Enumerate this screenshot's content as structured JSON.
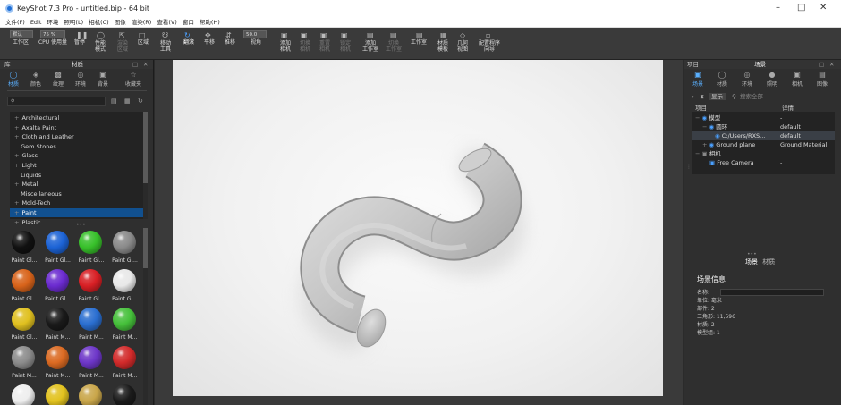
{
  "window": {
    "title": "KeyShot 7.3 Pro - untitled.bip - 64 bit",
    "minimize": "–",
    "maximize": "□",
    "close": "✕"
  },
  "menu": [
    "文件(F)",
    "Edit",
    "环境",
    "照明(L)",
    "相机(C)",
    "图像",
    "渲染(R)",
    "查看(V)",
    "窗口",
    "帮助(H)"
  ],
  "toolbar": {
    "combo1": "默认",
    "combo2": "75 %",
    "combo3": "50.0",
    "buttons": [
      "工作区",
      "CPU 使用量",
      "暂停",
      "性能\n模式",
      "渲染\n区域",
      "区域",
      "移动\n工具",
      "翻滚",
      "平移",
      "推移",
      "视角",
      "添加\n相机",
      "切换\n相机",
      "重置\n相机",
      "锁定\n相机",
      "添加\n工作室",
      "切换\n工作室",
      "工作室",
      "材质\n模板",
      "几何\n视图",
      "配置程序\n向导"
    ]
  },
  "left_panel": {
    "header_left": "库",
    "title": "材质",
    "tabs": [
      "材质",
      "颜色",
      "纹理",
      "环境",
      "背景",
      "收藏夹"
    ],
    "search_placeholder": "",
    "tree": [
      "Architectural",
      "Axalta Paint",
      "Cloth and Leather",
      "Gem Stones",
      "Glass",
      "Light",
      "Liquids",
      "Metal",
      "Miscellaneous",
      "Mold-Tech",
      "Paint",
      "Plastic"
    ],
    "tree_expandable": [
      true,
      true,
      true,
      false,
      true,
      true,
      false,
      true,
      false,
      true,
      true,
      true
    ],
    "selected_index": 10,
    "materials": [
      {
        "label": "Paint Gl...",
        "color": "#111111"
      },
      {
        "label": "Paint Gl...",
        "color": "#1c63d6"
      },
      {
        "label": "Paint Gl...",
        "color": "#37c02a"
      },
      {
        "label": "Paint Gl...",
        "color": "#8a8a8a"
      },
      {
        "label": "Paint Gl...",
        "color": "#d8631a"
      },
      {
        "label": "Paint Gl...",
        "color": "#6b2bd0"
      },
      {
        "label": "Paint Gl...",
        "color": "#d81f24"
      },
      {
        "label": "Paint Gl...",
        "color": "#e8e8e8"
      },
      {
        "label": "Paint Gl...",
        "color": "#e0c01f"
      },
      {
        "label": "Paint M...",
        "color": "#1a1a1a"
      },
      {
        "label": "Paint M...",
        "color": "#2a6ed0"
      },
      {
        "label": "Paint M...",
        "color": "#45c03a"
      },
      {
        "label": "Paint M...",
        "color": "#8c8c8c"
      },
      {
        "label": "Paint M...",
        "color": "#db6a22"
      },
      {
        "label": "Paint M...",
        "color": "#6d36c8"
      },
      {
        "label": "Paint M...",
        "color": "#d22a2a"
      },
      {
        "label": "",
        "color": "#eeeeee"
      },
      {
        "label": "",
        "color": "#e2c21e"
      },
      {
        "label": "",
        "color": "#c9a64a"
      },
      {
        "label": "",
        "color": "#1b1b1b"
      }
    ]
  },
  "right_panel": {
    "header_left": "项目",
    "title": "场景",
    "tabs": [
      "场景",
      "材质",
      "环境",
      "照明",
      "相机",
      "图像"
    ],
    "show_label": "显示",
    "search_placeholder": "搜索全部",
    "col_item": "项目",
    "col_detail": "详情",
    "tree": [
      {
        "name": "模型",
        "detail": "-"
      },
      {
        "name": "圆环",
        "detail": "default"
      },
      {
        "name": "C:/Users/RXS...",
        "detail": "default"
      },
      {
        "name": "Ground plane",
        "detail": "Ground Material"
      },
      {
        "name": "相机",
        "detail": ""
      },
      {
        "name": "Free Camera",
        "detail": "-"
      }
    ],
    "sub_tabs": [
      "场景",
      "材质"
    ],
    "info": {
      "title": "场景信息",
      "name_label": "名称:",
      "name_value": "",
      "unit": "单位: 毫米",
      "parts": "部件: 2",
      "triangles": "三角形: 11,596",
      "materials": "材质: 2",
      "groups": "模型组: 1"
    }
  }
}
